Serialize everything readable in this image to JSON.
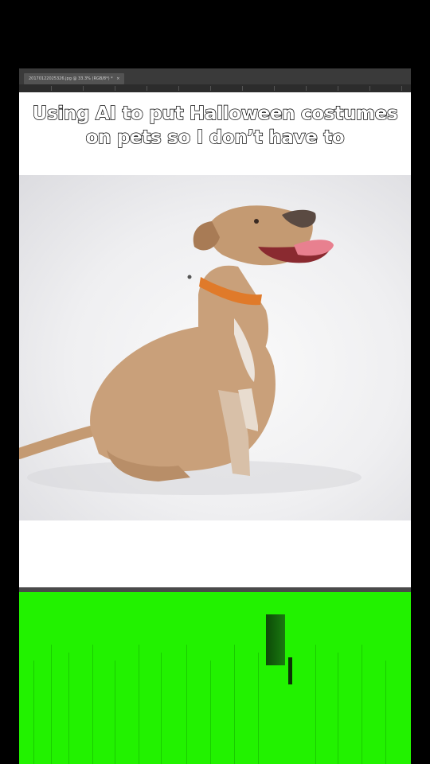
{
  "editor": {
    "tab_title": "20170122025326.jpg @ 33.3% (RGB/8*) *",
    "tab_close": "×"
  },
  "caption": {
    "text": "Using AI to put Halloween costumes on pets so I don’t have to"
  },
  "photo": {
    "subject_icon": "dog-photo",
    "collar_color": "#e07a2a"
  },
  "colors": {
    "background": "#000000",
    "greenscreen": "#22f200",
    "ps_dark": "#3a3a3a"
  }
}
